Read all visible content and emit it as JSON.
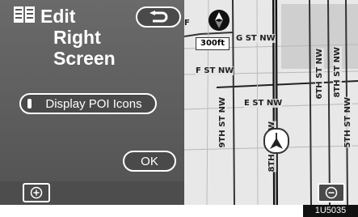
{
  "title": {
    "line1": "Edit",
    "line2": "Right",
    "line3": "Screen"
  },
  "buttons": {
    "back_icon": "u-turn-back-icon",
    "display_poi": "Display POI Icons",
    "ok": "OK",
    "zoom_in_icon": "zoom-in-icon",
    "zoom_out_icon": "zoom-out-icon"
  },
  "map": {
    "scale": "300ft",
    "compass_icon": "north-up-compass-icon",
    "vehicle_icon": "vehicle-position-icon",
    "labels": {
      "g_st_nw": "G ST NW",
      "f_st_nw": "F ST NW",
      "e_st_nw": "E ST NW",
      "ninth_st_nw": "9TH ST NW",
      "eighth_st_nw_a": "8TH ST NW",
      "eighth_st_nw_b": "8TH ST NW",
      "sixth_st_nw": "6TH ST NW",
      "fifth_st_nw": "5TH ST NW",
      "partial_left": "F"
    }
  },
  "image_code": "1U5035"
}
